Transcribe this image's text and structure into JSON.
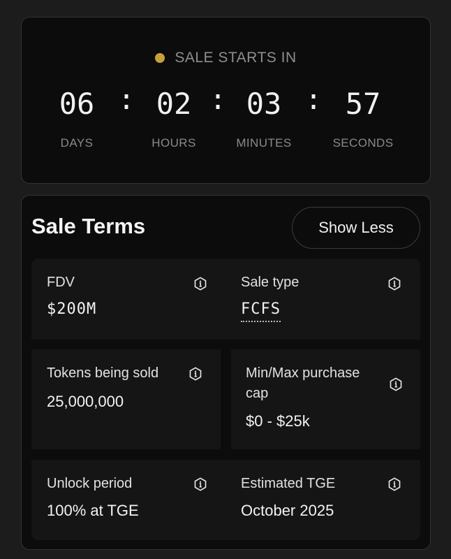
{
  "countdown": {
    "status_text": "SALE STARTS IN",
    "status_color": "#c6a13a",
    "units": [
      {
        "value": "06",
        "label": "DAYS"
      },
      {
        "value": "02",
        "label": "HOURS"
      },
      {
        "value": "03",
        "label": "MINUTES"
      },
      {
        "value": "57",
        "label": "SECONDS"
      }
    ],
    "separator": ":"
  },
  "terms": {
    "title": "Sale Terms",
    "toggle_label": "Show Less",
    "items": [
      {
        "label": "FDV",
        "value": "$200M",
        "icon": "info-icon"
      },
      {
        "label": "Sale type",
        "value": "FCFS",
        "icon": "info-icon"
      },
      {
        "label": "Tokens being sold",
        "value": "25,000,000",
        "icon": "info-icon"
      },
      {
        "label_line1": "Min/Max purchase",
        "label_line2": "cap",
        "value": "$0 - $25k",
        "icon": "info-icon"
      },
      {
        "label": "Unlock period",
        "value": "100% at TGE",
        "icon": "info-icon"
      },
      {
        "label": "Estimated TGE",
        "value": "October 2025",
        "icon": "info-icon"
      }
    ]
  }
}
